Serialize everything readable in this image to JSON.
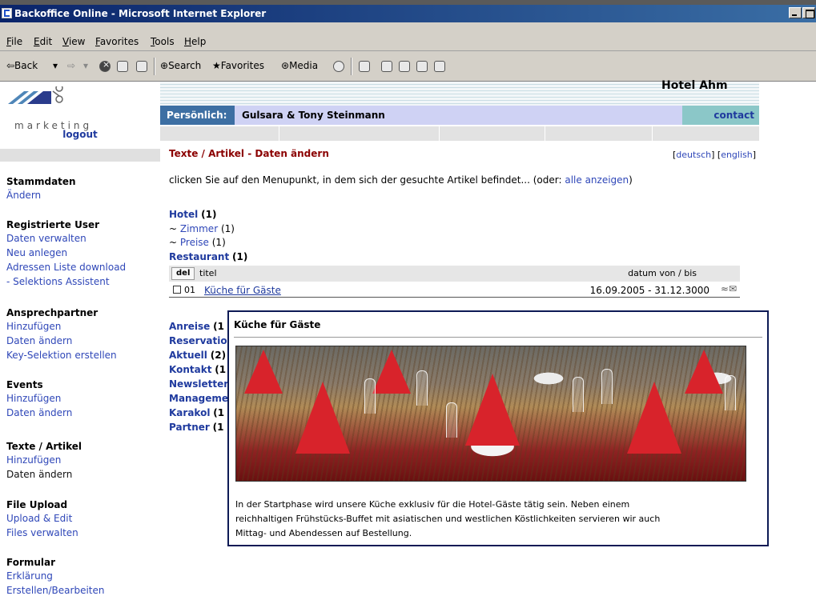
{
  "window": {
    "title": "Backoffice Online - Microsoft Internet Explorer",
    "menu": [
      "File",
      "Edit",
      "View",
      "Favorites",
      "Tools",
      "Help"
    ],
    "toolbar": {
      "back": "⇦Back",
      "back_arrow": "▾",
      "forward": "⇨",
      "forward_arrow": "▾",
      "search": "Search",
      "favorites": "Favorites",
      "media": "Media"
    }
  },
  "sidebar": {
    "logo_text": "marketing",
    "logout": "logout",
    "sections": [
      {
        "title": "Stammdaten",
        "items": [
          "Ändern"
        ]
      },
      {
        "title": "Registrierte User",
        "items": [
          "Daten verwalten",
          "Neu anlegen",
          "Adressen Liste download",
          "- Selektions Assistent"
        ]
      },
      {
        "title": "Ansprechpartner",
        "items": [
          "Hinzufügen",
          "Daten ändern",
          "Key-Selektion erstellen"
        ]
      },
      {
        "title": "Events",
        "items": [
          "Hinzufügen",
          "Daten ändern"
        ]
      },
      {
        "title": "Texte / Artikel",
        "items": [
          "Hinzufügen",
          "Daten ändern"
        ]
      },
      {
        "title": "File Upload",
        "items": [
          "Upload & Edit",
          "Files verwalten"
        ]
      },
      {
        "title": "Formular",
        "items": [
          "Erklärung",
          "Erstellen/Bearbeiten"
        ]
      }
    ]
  },
  "header": {
    "hotel_name": "Hotel Ahm",
    "personal_label": "Persönlich:",
    "personal_name": "Gulsara & Tony Steinmann",
    "contact": "contact"
  },
  "main": {
    "page_title": "Texte / Artikel - Daten ändern",
    "lang_de": "deutsch",
    "lang_en": "english",
    "instruction": "clicken Sie auf den Menupunkt, in dem sich der gesuchte Artikel befindet... (oder: ",
    "show_all": "alle anzeigen",
    "instruction_end": ")",
    "categories_top": [
      {
        "name": "Hotel",
        "count": "(1)"
      }
    ],
    "subcategories": [
      {
        "name": "Zimmer",
        "count": "(1)"
      },
      {
        "name": "Preise",
        "count": "(1)"
      }
    ],
    "restaurant": {
      "name": "Restaurant",
      "count": "(1)"
    },
    "table": {
      "del_label": "del",
      "col_title": "titel",
      "col_date": "datum von / bis",
      "rows": [
        {
          "no": "01",
          "title": "Küche für Gäste",
          "date": "16.09.2005 - 31.12.3000"
        }
      ]
    },
    "categories_bottom": [
      {
        "name": "Anreise",
        "count": "(1"
      },
      {
        "name": "Reservatio",
        "count": ""
      },
      {
        "name": "Aktuell",
        "count": "(2)"
      },
      {
        "name": "Kontakt",
        "count": "(1"
      },
      {
        "name": "Newsletter",
        "count": ""
      },
      {
        "name": "Manageme",
        "count": ""
      },
      {
        "name": "Karakol",
        "count": "(1"
      },
      {
        "name": "Partner",
        "count": "(1"
      }
    ]
  },
  "popup": {
    "title": "Küche für Gäste",
    "text": "In der Startphase wird unsere Küche exklusiv für die Hotel-Gäste tätig sein. Neben einem reichhaltigen Frühstücks-Buffet mit asiatischen und westlichen Köstlichkeiten servieren wir auch Mittag- und Abendessen auf Bestellung."
  },
  "colors": {
    "title_red": "#8b0000",
    "link_blue": "#1f3a9e",
    "personal_bar": "#cfd2f4",
    "personal_label_bg": "#3d6fa3",
    "contact_bg": "#8bc7c8",
    "popup_border": "#0d1a55"
  }
}
